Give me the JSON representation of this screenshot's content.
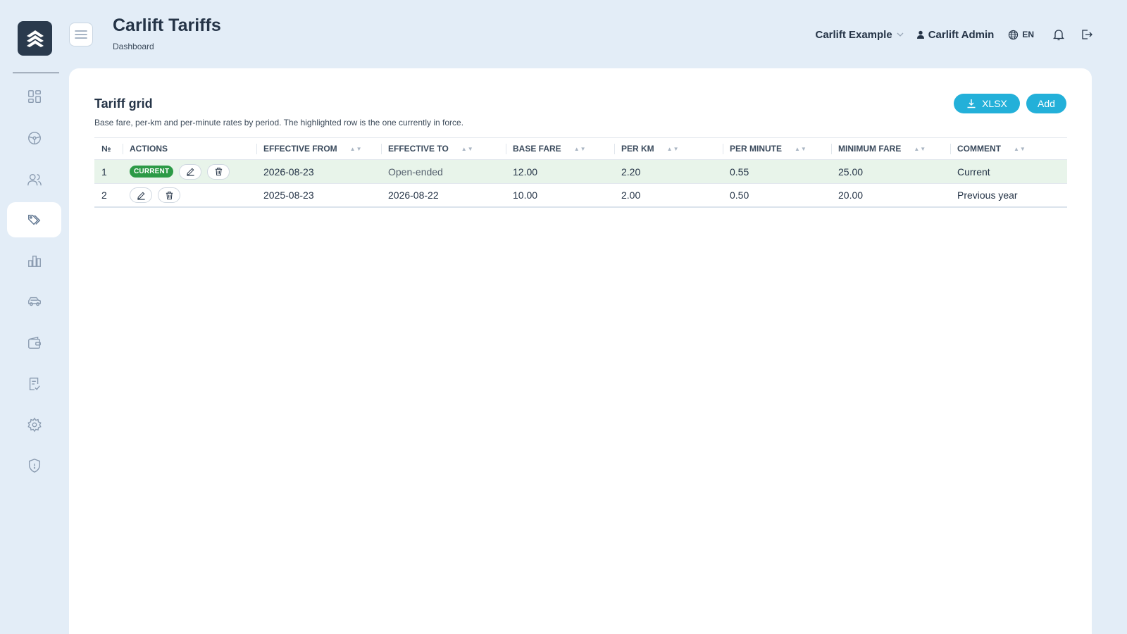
{
  "header": {
    "title": "Carlift Tariffs",
    "breadcrumb": "Dashboard",
    "org": "Carlift Example",
    "user": "Carlift Admin",
    "lang": "EN"
  },
  "sidebar": {
    "items": [
      {
        "name": "dashboard-icon"
      },
      {
        "name": "steering-wheel-icon"
      },
      {
        "name": "users-icon"
      },
      {
        "name": "tags-icon",
        "active": true
      },
      {
        "name": "bar-chart-icon"
      },
      {
        "name": "car-icon"
      },
      {
        "name": "wallet-icon"
      },
      {
        "name": "checklist-icon"
      },
      {
        "name": "gear-icon"
      },
      {
        "name": "shield-icon"
      }
    ]
  },
  "main": {
    "title": "Tariff grid",
    "subtitle": "Base fare, per-km and per-minute rates by period. The highlighted row is the one currently in force.",
    "buttons": {
      "xlsx": "XLSX",
      "add": "Add"
    },
    "columns": [
      "№",
      "Actions",
      "Effective from",
      "Effective to",
      "Base fare",
      "Per km",
      "Per minute",
      "Minimum fare",
      "Comment"
    ],
    "rows": [
      {
        "no": "1",
        "badge": "CURRENT",
        "from": "2026-08-23",
        "to": "Open-ended",
        "base": "12.00",
        "km": "2.20",
        "min": "0.55",
        "minfare": "25.00",
        "comment": "Current"
      },
      {
        "no": "2",
        "badge": "",
        "from": "2025-08-23",
        "to": "2026-08-22",
        "base": "10.00",
        "km": "2.00",
        "min": "0.50",
        "minfare": "20.00",
        "comment": "Previous year"
      }
    ]
  },
  "colors": {
    "accent": "#23b0d9",
    "current_row": "#e8f4ea",
    "badge": "#2c9a46",
    "sidebar_bg": "#e3edf7"
  }
}
